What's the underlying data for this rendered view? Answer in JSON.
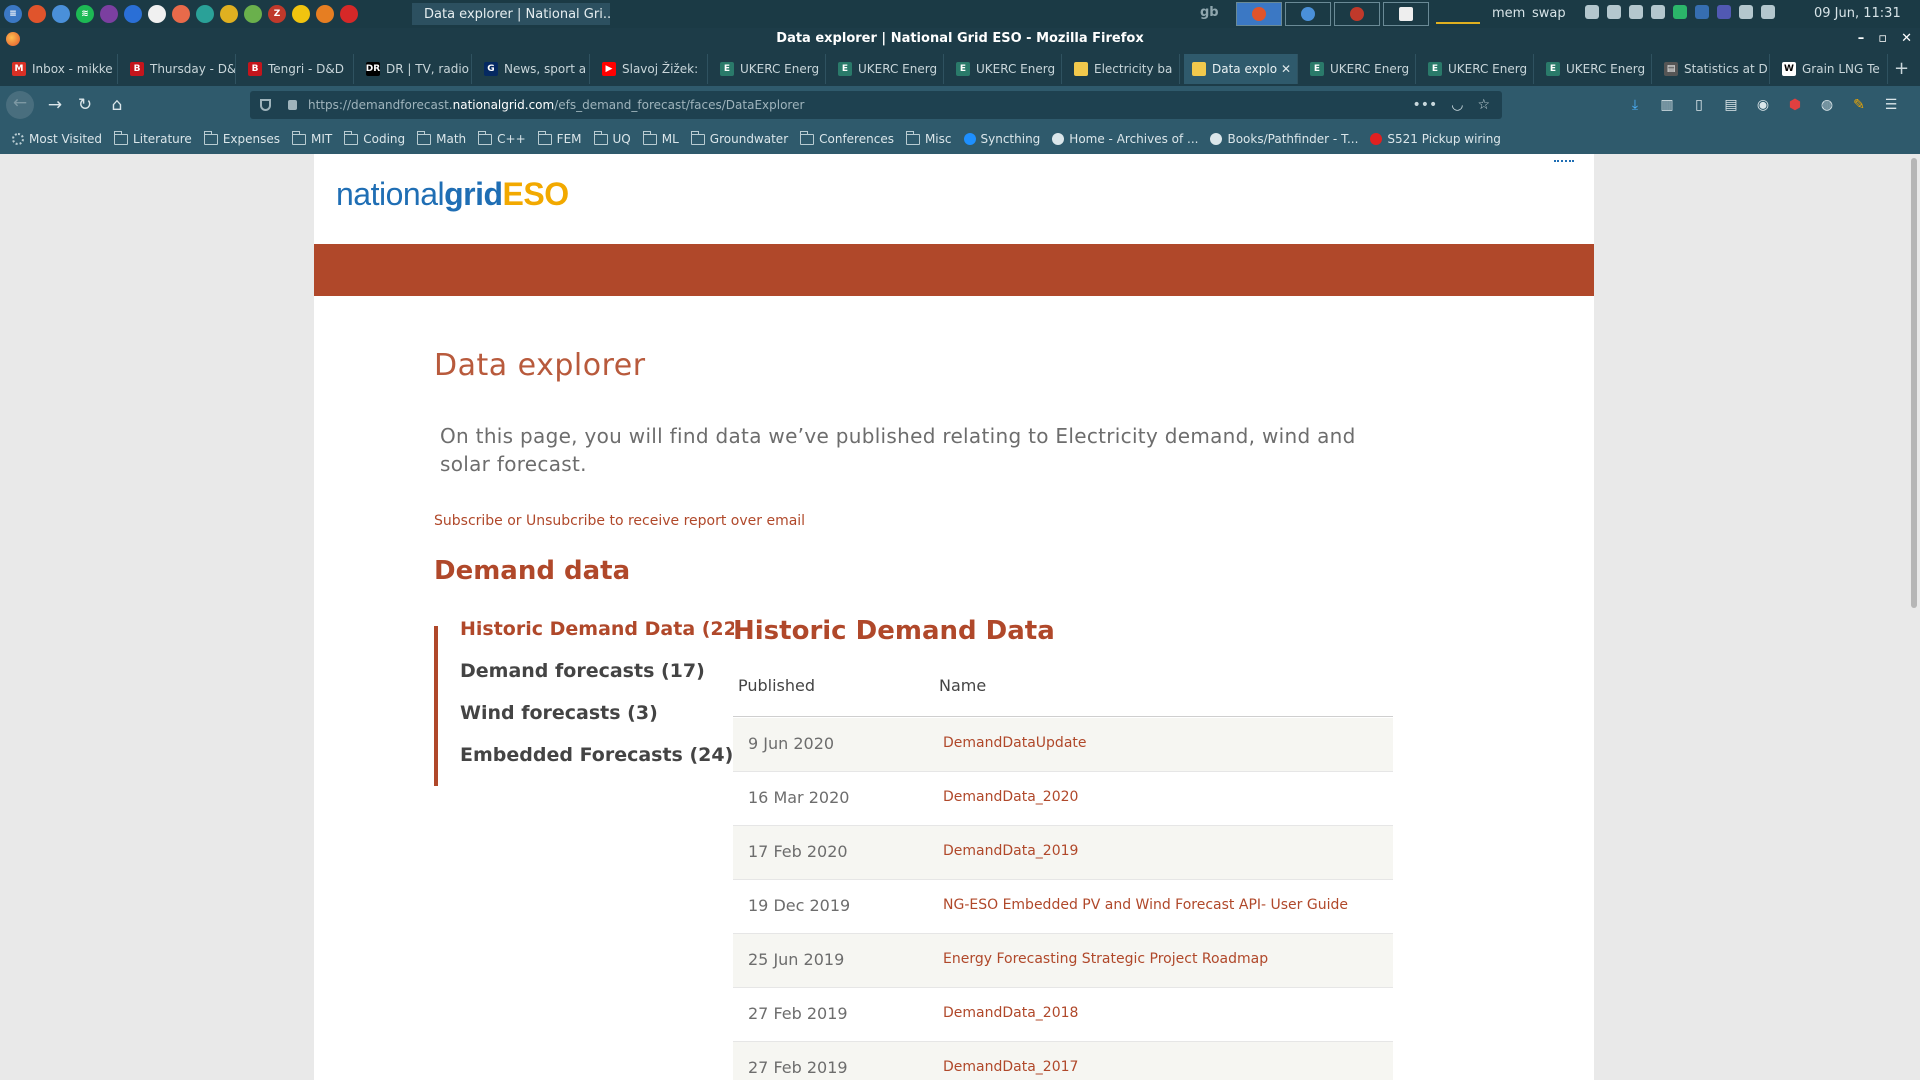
{
  "taskbar": {
    "active_task_title": "Data explorer | National Gri...",
    "keyboard_layout": "gb",
    "mem_label": "mem",
    "swap_label": "swap",
    "clock": "09 Jun, 11:31"
  },
  "window": {
    "title": "Data explorer | National Grid ESO - Mozilla Firefox"
  },
  "tabs": [
    {
      "label": "Inbox - mikke",
      "icon": "gmail-icon",
      "color": "#d93025",
      "glyph": "M"
    },
    {
      "label": "Thursday - D&",
      "icon": "b-icon",
      "color": "#c4151c",
      "glyph": "B"
    },
    {
      "label": "Tengri - D&D",
      "icon": "b-icon",
      "color": "#c4151c",
      "glyph": "B"
    },
    {
      "label": "DR | TV, radio",
      "icon": "dr-icon",
      "color": "#000000",
      "glyph": "DR"
    },
    {
      "label": "News, sport a",
      "icon": "guardian-icon",
      "color": "#052962",
      "glyph": "G"
    },
    {
      "label": "Slavoj Žižek:",
      "icon": "youtube-icon",
      "color": "#ff0000",
      "glyph": "▶"
    },
    {
      "label": "UKERC Energ",
      "icon": "e-icon",
      "color": "#2a7a6a",
      "glyph": "E"
    },
    {
      "label": "UKERC Energ",
      "icon": "e-icon",
      "color": "#2a7a6a",
      "glyph": "E"
    },
    {
      "label": "UKERC Energ",
      "icon": "e-icon",
      "color": "#2a7a6a",
      "glyph": "E"
    },
    {
      "label": "Electricity ba",
      "icon": "grid-icon",
      "color": "#f2c94c",
      "glyph": ""
    },
    {
      "label": "Data explo",
      "icon": "grid-icon",
      "color": "#f2c94c",
      "glyph": "",
      "active": true
    },
    {
      "label": "UKERC Energ",
      "icon": "e-icon",
      "color": "#2a7a6a",
      "glyph": "E"
    },
    {
      "label": "UKERC Energ",
      "icon": "e-icon",
      "color": "#2a7a6a",
      "glyph": "E"
    },
    {
      "label": "UKERC Energ",
      "icon": "e-icon",
      "color": "#2a7a6a",
      "glyph": "E"
    },
    {
      "label": "Statistics at D",
      "icon": "stats-icon",
      "color": "#555555",
      "glyph": "▤"
    },
    {
      "label": "Grain LNG Te",
      "icon": "wikipedia-icon",
      "color": "#ffffff",
      "glyph": "W"
    }
  ],
  "url": {
    "prefix": "https://demandforecast.",
    "domain": "nationalgrid.com",
    "path": "/efs_demand_forecast/faces/DataExplorer"
  },
  "bookmarks": [
    {
      "label": "Most Visited",
      "icon": "gear-icon"
    },
    {
      "label": "Literature",
      "icon": "folder-icon"
    },
    {
      "label": "Expenses",
      "icon": "folder-icon"
    },
    {
      "label": "MIT",
      "icon": "folder-icon"
    },
    {
      "label": "Coding",
      "icon": "folder-icon"
    },
    {
      "label": "Math",
      "icon": "folder-icon"
    },
    {
      "label": "C++",
      "icon": "folder-icon"
    },
    {
      "label": "FEM",
      "icon": "folder-icon"
    },
    {
      "label": "UQ",
      "icon": "folder-icon"
    },
    {
      "label": "ML",
      "icon": "folder-icon"
    },
    {
      "label": "Groundwater",
      "icon": "folder-icon"
    },
    {
      "label": "Conferences",
      "icon": "folder-icon"
    },
    {
      "label": "Misc",
      "icon": "folder-icon"
    },
    {
      "label": "Syncthing",
      "icon": "syncthing-icon"
    },
    {
      "label": "Home - Archives of ...",
      "icon": "archive-icon"
    },
    {
      "label": "Books/Pathfinder - T...",
      "icon": "page-icon"
    },
    {
      "label": "S521 Pickup wiring",
      "icon": "target-icon"
    }
  ],
  "site": {
    "logo": {
      "part1": "national",
      "part2": "grid",
      "part3": "ESO"
    },
    "page_title": "Data explorer",
    "intro": "On this page, you will find data we’ve published relating to Electricity demand, wind and solar forecast.",
    "subscribe_link": "Subscribe or Unsubcribe to receive report over email",
    "section_title": "Demand data",
    "side_nav": [
      {
        "label": "Historic Demand Data (22)",
        "active": true
      },
      {
        "label": "Demand forecasts (17)"
      },
      {
        "label": "Wind forecasts (3)"
      },
      {
        "label": "Embedded Forecasts (24)"
      }
    ],
    "table_title": "Historic Demand Data",
    "table_headers": {
      "published": "Published",
      "name": "Name"
    },
    "rows": [
      {
        "published": "9 Jun 2020",
        "name": "DemandDataUpdate"
      },
      {
        "published": "16 Mar 2020",
        "name": "DemandData_2020"
      },
      {
        "published": "17 Feb 2020",
        "name": "DemandData_2019"
      },
      {
        "published": "19 Dec 2019",
        "name": "NG-ESO Embedded PV and Wind Forecast API- User Guide"
      },
      {
        "published": "25 Jun 2019",
        "name": "Energy Forecasting Strategic Project Roadmap"
      },
      {
        "published": "27 Feb 2019",
        "name": "DemandData_2018"
      },
      {
        "published": "27 Feb 2019",
        "name": "DemandData_2017"
      }
    ],
    "colors": {
      "accent": "#b0482a",
      "logo_blue": "#1f6eb4",
      "logo_gold": "#f2a900"
    }
  }
}
